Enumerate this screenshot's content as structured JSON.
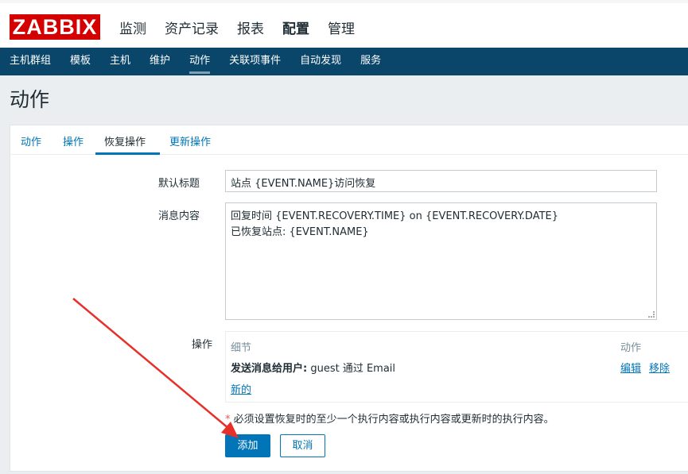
{
  "header": {
    "logo_text": "ZABBIX",
    "menu": [
      "监测",
      "资产记录",
      "报表",
      "配置",
      "管理"
    ],
    "active_menu": "配置"
  },
  "subnav": {
    "items": [
      "主机群组",
      "模板",
      "主机",
      "维护",
      "动作",
      "关联项事件",
      "自动发现",
      "服务"
    ],
    "active": "动作"
  },
  "page": {
    "title": "动作"
  },
  "tabs": {
    "items": [
      "动作",
      "操作",
      "恢复操作",
      "更新操作"
    ],
    "active": "恢复操作"
  },
  "form": {
    "subject_label": "默认标题",
    "subject_value": "站点 {EVENT.NAME}访问恢复",
    "message_label": "消息内容",
    "message_lines": [
      "回复时间 {EVENT.RECOVERY.TIME} on {EVENT.RECOVERY.DATE}",
      "已恢复站点: {EVENT.NAME}"
    ],
    "operations_label": "操作",
    "operations": {
      "col_details": "细节",
      "col_action": "动作",
      "row_bold": "发送消息给用户:",
      "row_rest": " guest 通过 Email",
      "edit": "编辑",
      "remove": "移除",
      "new": "新的"
    },
    "note_star": "*",
    "note_text": " 必须设置恢复时的至少一个执行内容或执行内容或更新时的执行内容。",
    "add_button": "添加",
    "cancel_button": "取消"
  },
  "colors": {
    "brand_red": "#d40000",
    "nav_blue": "#0a466a",
    "link_blue": "#0275b8",
    "annotation_red": "#e8302a"
  }
}
